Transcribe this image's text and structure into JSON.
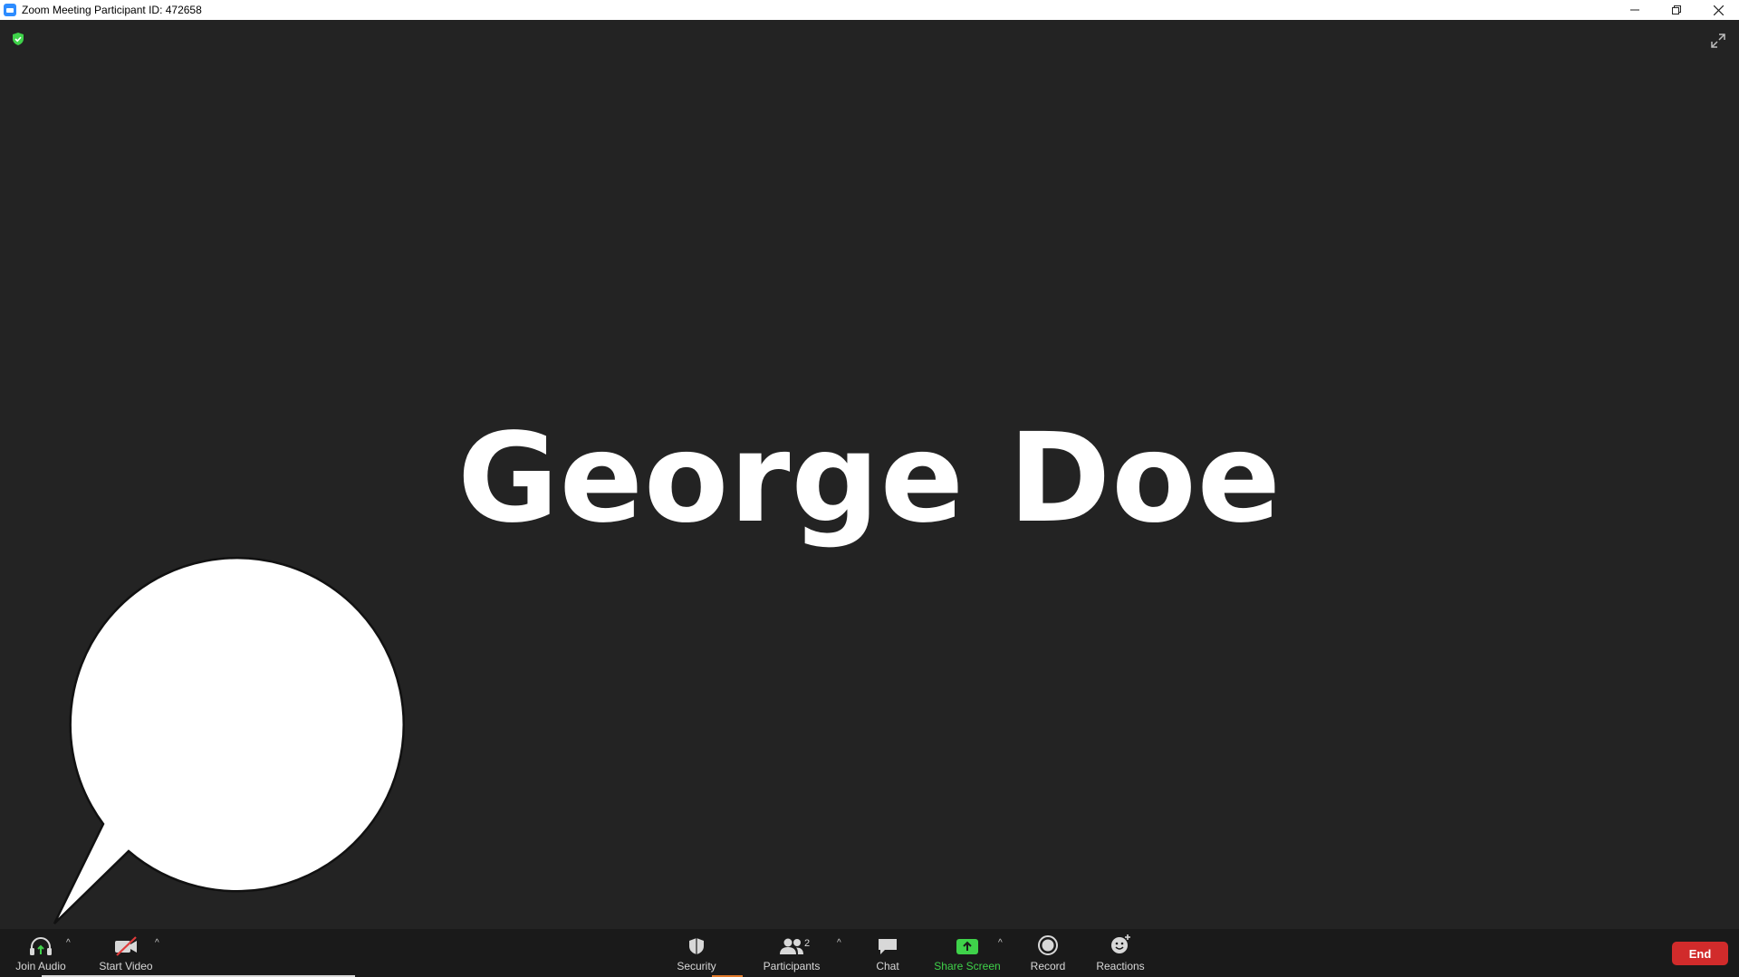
{
  "window": {
    "title": "Zoom Meeting Participant ID: 472658",
    "minimize_icon": "minimize-icon",
    "restore_icon": "restore-icon",
    "close_icon": "close-icon"
  },
  "meeting": {
    "participant_name": "George Doe",
    "encryption_icon": "shield-check-icon",
    "fullscreen_icon": "fullscreen-icon"
  },
  "toolbar": {
    "join_audio": "Join Audio",
    "start_video": "Start Video",
    "security": "Security",
    "participants": "Participants",
    "participants_count": "2",
    "chat": "Chat",
    "share_screen": "Share Screen",
    "record": "Record",
    "reactions": "Reactions",
    "end": "End"
  },
  "colors": {
    "background": "#232323",
    "toolbar": "#1a1a1a",
    "share_screen_green": "#3fd24a",
    "end_red": "#d12b2b",
    "shield_green": "#3fd24a"
  }
}
